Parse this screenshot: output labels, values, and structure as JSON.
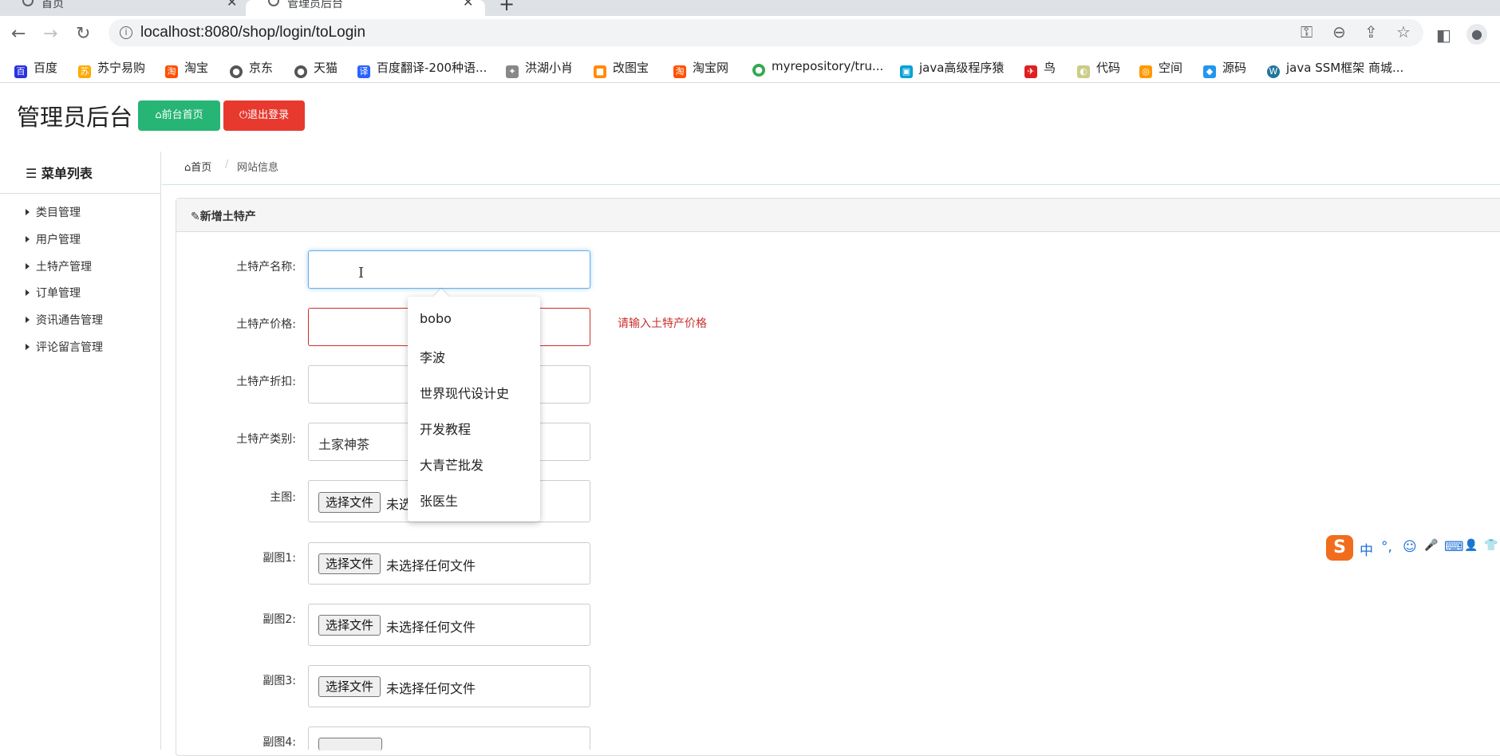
{
  "browser": {
    "tabs": [
      {
        "title": "首页",
        "close": "✕"
      },
      {
        "title": "管理员后台",
        "close": "✕"
      }
    ],
    "new_tab": "+",
    "url": "localhost:8080/shop/login/toLogin",
    "bookmarks": [
      {
        "label": "百度",
        "color": "#2932e1",
        "glyph": "百"
      },
      {
        "label": "苏宁易购",
        "color": "#ffaa00",
        "glyph": "苏"
      },
      {
        "label": "淘宝",
        "color": "#ff5000",
        "glyph": "淘"
      },
      {
        "label": "京东",
        "color": "#555555",
        "glyph": "●"
      },
      {
        "label": "天猫",
        "color": "#555555",
        "glyph": "●"
      },
      {
        "label": "百度翻译-200种语...",
        "color": "#2a62ff",
        "glyph": "译"
      },
      {
        "label": "洪湖小肖",
        "color": "#888888",
        "glyph": "✦"
      },
      {
        "label": "改图宝",
        "color": "#ff8a00",
        "glyph": "■"
      },
      {
        "label": "淘宝网",
        "color": "#ff5000",
        "glyph": "淘"
      },
      {
        "label": "myrepository/tru...",
        "color": "#34a853",
        "glyph": "●"
      },
      {
        "label": "java高级程序猿",
        "color": "#00a1d6",
        "glyph": "▣"
      },
      {
        "label": "鸟",
        "color": "#e02020",
        "glyph": "✈"
      },
      {
        "label": "代码",
        "color": "#cccc88",
        "glyph": "◐"
      },
      {
        "label": "空间",
        "color": "#ff9900",
        "glyph": "◎"
      },
      {
        "label": "源码",
        "color": "#2496ed",
        "glyph": "◆"
      },
      {
        "label": "java SSM框架 商城...",
        "color": "#21759b",
        "glyph": "W"
      }
    ]
  },
  "app": {
    "title": "管理员后台",
    "btn_home": "前台首页",
    "btn_logout": "退出登录",
    "home_icon": "home-icon",
    "power_icon": "power-icon"
  },
  "sidebar": {
    "title": "菜单列表",
    "items": [
      {
        "label": "类目管理"
      },
      {
        "label": "用户管理"
      },
      {
        "label": "土特产管理"
      },
      {
        "label": "订单管理"
      },
      {
        "label": "资讯通告管理"
      },
      {
        "label": "评论留言管理"
      }
    ]
  },
  "breadcrumb": {
    "home": "首页",
    "separator": "/",
    "current": "网站信息"
  },
  "panel": {
    "title": "新增土特产"
  },
  "form": {
    "name_label": "土特产名称:",
    "price_label": "土特产价格:",
    "price_error": "请输入土特产价格",
    "discount_label": "土特产折扣:",
    "category_label": "土特产类别:",
    "category_value": "土家神茶",
    "main_image_label": "主图:",
    "sub1_label": "副图1:",
    "sub2_label": "副图2:",
    "sub3_label": "副图3:",
    "sub4_label": "副图4:",
    "file_button": "选择文件",
    "no_file": "未选择任何文件",
    "no_file_partial": "未选"
  },
  "autocomplete": {
    "options": [
      "bobo",
      "李波",
      "世界现代设计史",
      "开发教程",
      "大青芒批发",
      "张医生"
    ]
  },
  "ime": {
    "logo": "S",
    "mode": "中",
    "punct": "°,",
    "items": [
      "☺",
      "🎤",
      "⌨",
      "👤",
      "👕"
    ]
  },
  "colors": {
    "success": "#26b574",
    "danger": "#e8392f",
    "focus": "#66afe9",
    "error": "#c9302c"
  }
}
